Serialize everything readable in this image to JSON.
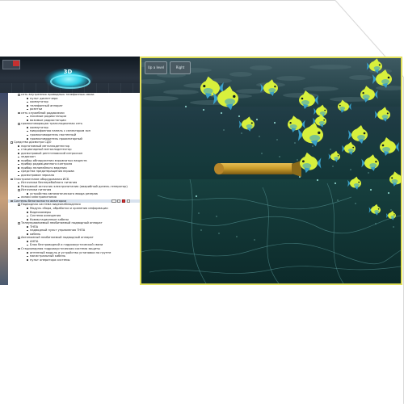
{
  "left_panel": {
    "header": {
      "badge": "3D"
    },
    "tree": [
      {
        "level": 2,
        "type": "expander",
        "text": "сеть внутренних проводных телефонных связи"
      },
      {
        "level": 3,
        "type": "bullet",
        "text": "пульт диспетчера"
      },
      {
        "level": 3,
        "type": "bullet",
        "text": "коммутатор"
      },
      {
        "level": 3,
        "type": "bullet",
        "text": "телефонный аппарат"
      },
      {
        "level": 3,
        "type": "bullet",
        "text": "розетки"
      },
      {
        "level": 2,
        "type": "expander",
        "text": "сеть служебной радиосвязи"
      },
      {
        "level": 3,
        "type": "bullet",
        "text": "носимые радиостанции"
      },
      {
        "level": 3,
        "type": "bullet",
        "text": "возимые радиостанции"
      },
      {
        "level": 2,
        "type": "expander",
        "text": "громкоговорящая трансляционная сеть"
      },
      {
        "level": 3,
        "type": "bullet",
        "text": "коммутатор"
      },
      {
        "level": 3,
        "type": "bullet",
        "text": "микрофонная панель с селектором зон"
      },
      {
        "level": 3,
        "type": "bullet",
        "text": "громкоговоритель настенный"
      },
      {
        "level": 3,
        "type": "bullet",
        "text": "громкоговоритель прожекторный"
      },
      {
        "level": 1,
        "type": "expander",
        "text": "Средства досмотра СДО"
      },
      {
        "level": 2,
        "type": "bullet",
        "text": "портативный металлодетектор"
      },
      {
        "level": 2,
        "type": "bullet",
        "text": "стационарный металлодетектор"
      },
      {
        "level": 2,
        "type": "bullet",
        "text": "досмотровый рентгеновский интроскоп"
      },
      {
        "level": 2,
        "type": "bullet",
        "text": "эндоскоп"
      },
      {
        "level": 2,
        "type": "bullet",
        "text": "прибор обнаружения взрывчатых веществ"
      },
      {
        "level": 2,
        "type": "bullet",
        "text": "прибор радиационного контроля"
      },
      {
        "level": 2,
        "type": "bullet",
        "text": "прибор нелинейного ведения"
      },
      {
        "level": 2,
        "type": "bullet",
        "text": "средства предотвращения взрыва"
      },
      {
        "level": 2,
        "type": "bullet",
        "text": "досмотровое зеркало"
      },
      {
        "level": 1,
        "type": "expander",
        "text": "Электропитание оборудования ИСБ"
      },
      {
        "level": 2,
        "type": "bullet",
        "text": "Источники бесперебойного питания"
      },
      {
        "level": 2,
        "type": "bullet",
        "text": "Резервный источник электропитания (аварийный дизель-генератор)"
      },
      {
        "level": 2,
        "type": "expander",
        "text": "Источники питания"
      },
      {
        "level": 3,
        "type": "bullet",
        "text": "устройство автоматического ввода резерва"
      },
      {
        "level": 2,
        "type": "bullet",
        "text": "линии электропитания"
      },
      {
        "level": 1,
        "type": "expander",
        "text": "Системы безопасности акватории",
        "selected": true,
        "prefix": "Под"
      },
      {
        "level": 2,
        "type": "expander",
        "text": "Подводная система видеонаблюдения"
      },
      {
        "level": 3,
        "type": "bullet",
        "text": "Модуль сбора, обработки и хранения информации"
      },
      {
        "level": 3,
        "type": "bullet",
        "text": "Видеокамеры"
      },
      {
        "level": 3,
        "type": "bullet",
        "text": "Система освещения"
      },
      {
        "level": 3,
        "type": "bullet",
        "text": "Коммутационные кабели"
      },
      {
        "level": 2,
        "type": "expander",
        "text": "Телеуправляемый необитаемый подводный аппарат"
      },
      {
        "level": 3,
        "type": "bullet",
        "text": "ТНПА"
      },
      {
        "level": 3,
        "type": "bullet",
        "text": "надводный пульт управления ТНПА"
      },
      {
        "level": 3,
        "type": "bullet",
        "text": "кабель"
      },
      {
        "level": 2,
        "type": "expander",
        "text": "Автономный необитаемый подводный аппарат"
      },
      {
        "level": 3,
        "type": "bullet",
        "text": "АНПА"
      },
      {
        "level": 3,
        "type": "bullet",
        "text": "Блок бестроводной и гидроакустической связи"
      },
      {
        "level": 2,
        "type": "expander",
        "text": "Стационарная гидроакустическая система защиты"
      },
      {
        "level": 3,
        "type": "bullet",
        "text": "антенный модуль и устройство установки на грунте"
      },
      {
        "level": 3,
        "type": "bullet",
        "text": "магистральный кабель"
      },
      {
        "level": 3,
        "type": "bullet",
        "text": "пульт оператора системы"
      }
    ]
  },
  "view3d": {
    "buttons": [
      {
        "label": "Up a level"
      },
      {
        "label": "Right"
      }
    ]
  },
  "colors": {
    "view_border": "#e2e05a",
    "fish_body": "#d8f03c",
    "fish_fin": "#3aa0c8",
    "torpedo": "#c89a2a",
    "water": "#163a3c"
  },
  "icons": {
    "header_badge": "glowing-3d-ring-icon",
    "expander": "tree-expander-icon",
    "bullet": "tree-bullet-icon"
  }
}
